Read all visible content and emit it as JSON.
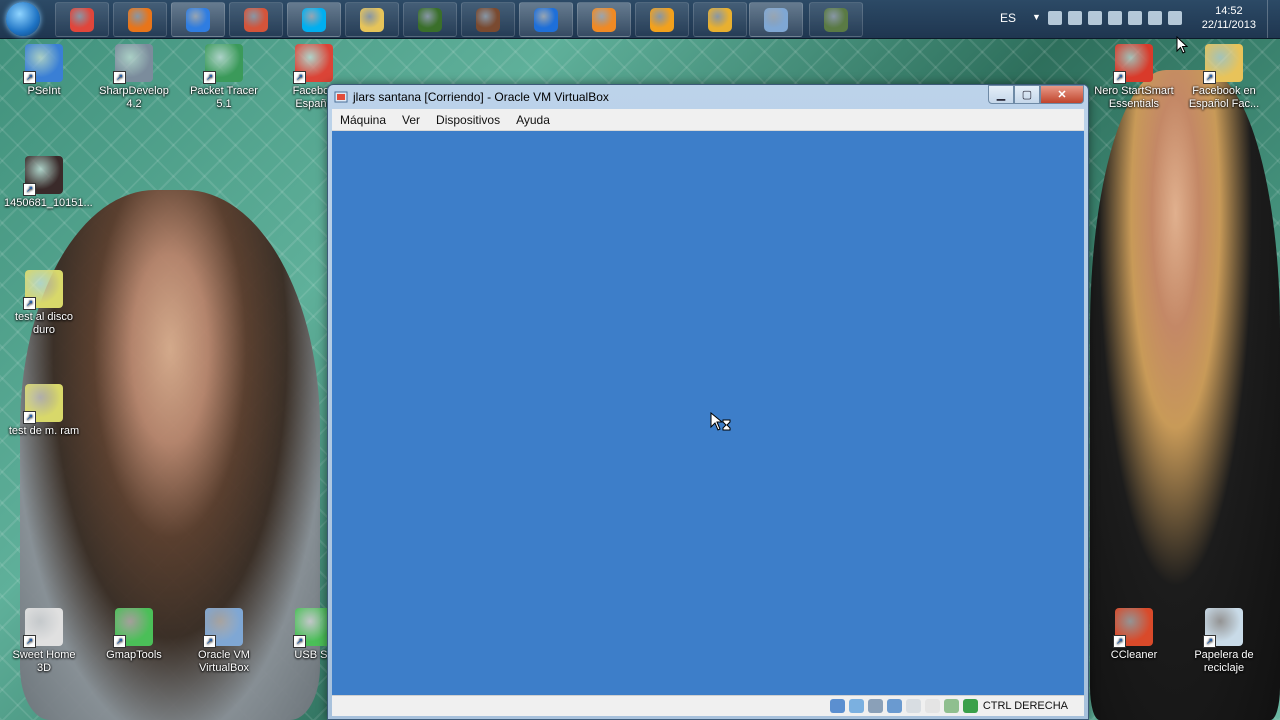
{
  "taskbar": {
    "pinned": [
      {
        "name": "chrome-icon",
        "color": "#e0463b"
      },
      {
        "name": "firefox-icon",
        "color": "#e8751a"
      },
      {
        "name": "messenger-icon",
        "color": "#2f7de1"
      },
      {
        "name": "gamemaker-icon",
        "color": "#d4543a"
      },
      {
        "name": "skype-icon",
        "color": "#00aff0"
      },
      {
        "name": "folder-icon",
        "color": "#e6c45a"
      },
      {
        "name": "app-green-icon",
        "color": "#3a6f2a"
      },
      {
        "name": "avatar-app-icon",
        "color": "#7a4a30"
      },
      {
        "name": "teamviewer-icon",
        "color": "#1e6fd9"
      },
      {
        "name": "media-player-icon",
        "color": "#f08a24"
      },
      {
        "name": "avast-icon",
        "color": "#f2a11d"
      },
      {
        "name": "launcher-icon",
        "color": "#e8b030"
      },
      {
        "name": "virtualbox-icon",
        "color": "#7fa7d4"
      },
      {
        "name": "camera-app-icon",
        "color": "#5a7a44"
      }
    ],
    "tray": {
      "language": "ES",
      "time": "14:52",
      "date": "22/11/2013"
    }
  },
  "desktop_icons": {
    "left": [
      {
        "label": "PSeInt",
        "color": "#3a7fd5"
      },
      {
        "label": "SharpDevelop 4.2",
        "color": "#7b8c9c"
      },
      {
        "label": "Packet Tracer 5.1",
        "color": "#3b9a5a"
      },
      {
        "label": "Faceboo Españo",
        "color": "#db4437"
      },
      {
        "label": "1450681_10151...",
        "color": "#3a2a2a"
      },
      {
        "label": "test al disco duro",
        "color": "#d8d86a"
      },
      {
        "label": "test de m. ram",
        "color": "#d8d86a"
      },
      {
        "label": "Sweet Home 3D",
        "color": "#e0e0e0"
      },
      {
        "label": "GmapTools",
        "color": "#4bbf58"
      },
      {
        "label": "Oracle VM VirtualBox",
        "color": "#7fa7d4"
      },
      {
        "label": "USB Sh",
        "color": "#4bbf58"
      }
    ],
    "right": [
      {
        "label": "Nero StartSmart Essentials",
        "color": "#d93a2a"
      },
      {
        "label": "Facebook en Español Fac...",
        "color": "#e8c35a"
      },
      {
        "label": "CCleaner",
        "color": "#d94a2a"
      },
      {
        "label": "Papelera de reciclaje",
        "color": "#c9dbe8"
      }
    ]
  },
  "window": {
    "title": "jlars santana [Corriendo] - Oracle VM VirtualBox",
    "menu": [
      "Máquina",
      "Ver",
      "Dispositivos",
      "Ayuda"
    ],
    "screen_color": "#3d7ec9",
    "host_key": "CTRL DERECHA"
  }
}
